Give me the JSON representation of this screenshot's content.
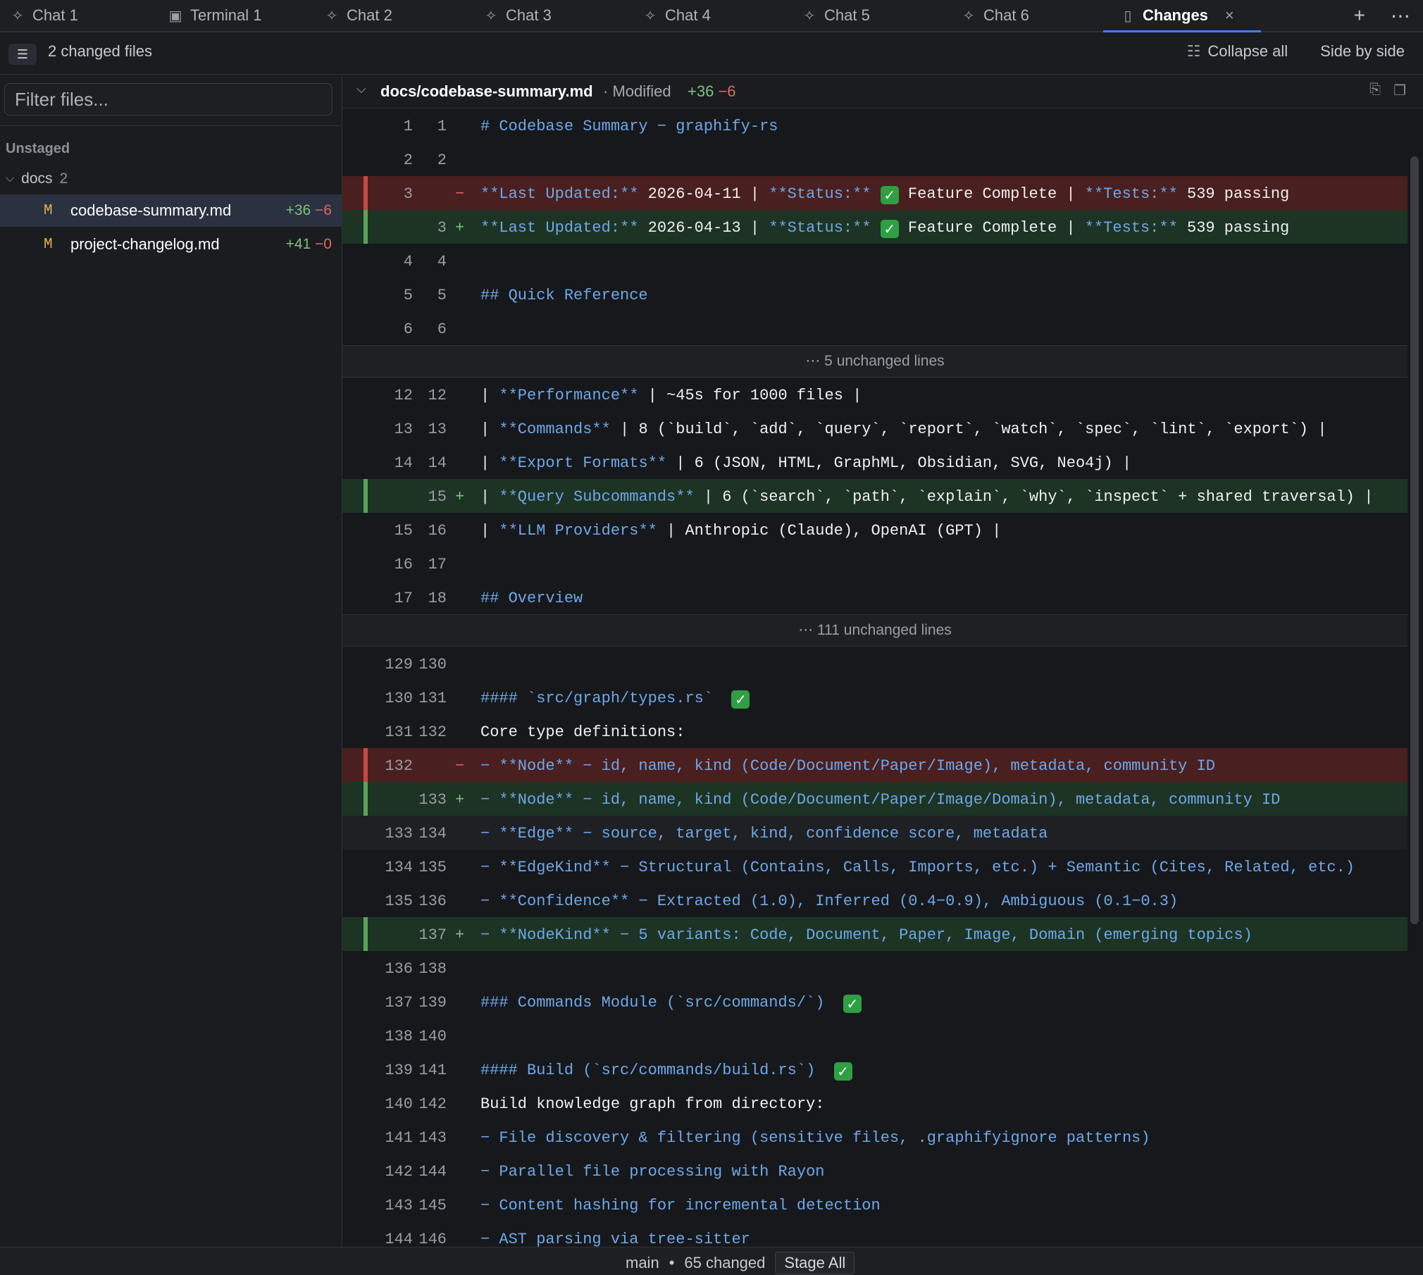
{
  "tabs": [
    {
      "label": "Chat 1",
      "icon": "sparkle-icon"
    },
    {
      "label": "Terminal 1",
      "icon": "terminal-icon"
    },
    {
      "label": "Chat 2",
      "icon": "sparkle-icon"
    },
    {
      "label": "Chat 3",
      "icon": "sparkle-icon"
    },
    {
      "label": "Chat 4",
      "icon": "sparkle-icon"
    },
    {
      "label": "Chat 5",
      "icon": "sparkle-icon"
    },
    {
      "label": "Chat 6",
      "icon": "sparkle-icon"
    },
    {
      "label": "Changes",
      "icon": "file-icon",
      "active": true
    }
  ],
  "toolbar": {
    "changed_files": "2 changed files",
    "collapse_all": "Collapse all",
    "side_by_side": "Side by side"
  },
  "sidebar": {
    "filter_placeholder": "Filter files...",
    "section": "Unstaged",
    "folder": {
      "name": "docs",
      "count": "2"
    },
    "files": [
      {
        "status": "M",
        "name": "codebase-summary.md",
        "added": "+36",
        "removed": "−6",
        "selected": true
      },
      {
        "status": "M",
        "name": "project-changelog.md",
        "added": "+41",
        "removed": "−0",
        "selected": false
      }
    ]
  },
  "file_header": {
    "path": "docs/codebase-summary.md",
    "status": "· Modified",
    "added": "+36",
    "removed": "−6"
  },
  "folds": {
    "first": "⋯ 5 unchanged lines",
    "second": "⋯ 111 unchanged lines"
  },
  "lines": {
    "l1": {
      "a": "1",
      "b": "1",
      "code": "# Codebase Summary − graphify-rs"
    },
    "l2": {
      "a": "2",
      "b": "2"
    },
    "l3del": {
      "a": "3",
      "mk": "−",
      "p1": "**Last Updated:**",
      "p2": " 2026-04-11 | ",
      "p3": "**Status:**",
      "p4": " Feature Complete | ",
      "p5": "**Tests:**",
      "p6": " 539 passing"
    },
    "l3add": {
      "b": "3",
      "mk": "+",
      "p1": "**Last Updated:**",
      "p2": " 2026-04-13 | ",
      "p3": "**Status:**",
      "p4": " Feature Complete | ",
      "p5": "**Tests:**",
      "p6": " 539 passing"
    },
    "l4": {
      "a": "4",
      "b": "4"
    },
    "l5": {
      "a": "5",
      "b": "5",
      "code": "## Quick Reference"
    },
    "l6": {
      "a": "6",
      "b": "6"
    },
    "l12": {
      "a": "12",
      "b": "12",
      "p1": "| ",
      "p2": "**Performance**",
      "p3": " | ~45s for 1000 files |"
    },
    "l13": {
      "a": "13",
      "b": "13",
      "p1": "| ",
      "p2": "**Commands**",
      "p3": " | 8 (`build`, `add`, `query`, `report`, `watch`, `spec`, `lint`, `export`) |"
    },
    "l14": {
      "a": "14",
      "b": "14",
      "p1": "| ",
      "p2": "**Export Formats**",
      "p3": " | 6 (JSON, HTML, GraphML, Obsidian, SVG, Neo4j) |"
    },
    "l15add": {
      "b": "15",
      "mk": "+",
      "p1": "| ",
      "p2": "**Query Subcommands**",
      "p3": " | 6 (`search`, `path`, `explain`, `why`, `inspect` + shared traversal) |"
    },
    "l16": {
      "a": "15",
      "b": "16",
      "p1": "| ",
      "p2": "**LLM Providers**",
      "p3": " | Anthropic (Claude), OpenAI (GPT) |"
    },
    "l17": {
      "a": "16",
      "b": "17"
    },
    "l18": {
      "a": "17",
      "b": "18",
      "code": "## Overview"
    },
    "l130": {
      "a": "129",
      "b": "130"
    },
    "l131": {
      "a": "130",
      "b": "131",
      "code": "#### `src/graph/types.rs` "
    },
    "l132": {
      "a": "131",
      "b": "132",
      "code": "Core type definitions:"
    },
    "l132del": {
      "a": "132",
      "mk": "−",
      "code": "− **Node** − id, name, kind (Code/Document/Paper/Image), metadata, community ID"
    },
    "l133add": {
      "b": "133",
      "mk": "+",
      "code": "− **Node** − id, name, kind (Code/Document/Paper/Image/Domain), metadata, community ID"
    },
    "l134": {
      "a": "133",
      "b": "134",
      "code": "− **Edge** − source, target, kind, confidence score, metadata"
    },
    "l135": {
      "a": "134",
      "b": "135",
      "code": "− **EdgeKind** − Structural (Contains, Calls, Imports, etc.) + Semantic (Cites, Related, etc.)"
    },
    "l136": {
      "a": "135",
      "b": "136",
      "code": "− **Confidence** − Extracted (1.0), Inferred (0.4−0.9), Ambiguous (0.1−0.3)"
    },
    "l137add": {
      "b": "137",
      "mk": "+",
      "code": "− **NodeKind** − 5 variants: Code, Document, Paper, Image, Domain (emerging topics)"
    },
    "l138": {
      "a": "136",
      "b": "138"
    },
    "l139": {
      "a": "137",
      "b": "139",
      "code": "### Commands Module (`src/commands/`) "
    },
    "l140": {
      "a": "138",
      "b": "140"
    },
    "l141": {
      "a": "139",
      "b": "141",
      "code": "#### Build (`src/commands/build.rs`) "
    },
    "l142": {
      "a": "140",
      "b": "142",
      "code": "Build knowledge graph from directory:"
    },
    "l143": {
      "a": "141",
      "b": "143",
      "code": "− File discovery & filtering (sensitive files, .graphifyignore patterns)"
    },
    "l144": {
      "a": "142",
      "b": "144",
      "code": "− Parallel file processing with Rayon"
    },
    "l145": {
      "a": "143",
      "b": "145",
      "code": "− Content hashing for incremental detection"
    },
    "l146": {
      "a": "144",
      "b": "146",
      "code": "− AST parsing via tree-sitter"
    }
  },
  "statusbar": {
    "branch": "main",
    "dot": "•",
    "changed": "65 changed",
    "stage_all": "Stage All"
  },
  "colors": {
    "accent": "#3b82f6",
    "added_bg": "#1d3324",
    "removed_bg": "#4a1f1f",
    "added_text": "#7ec27e",
    "removed_text": "#e0685e",
    "modified_marker": "#e2b34b",
    "markdown_blue": "#6ea8e8"
  }
}
